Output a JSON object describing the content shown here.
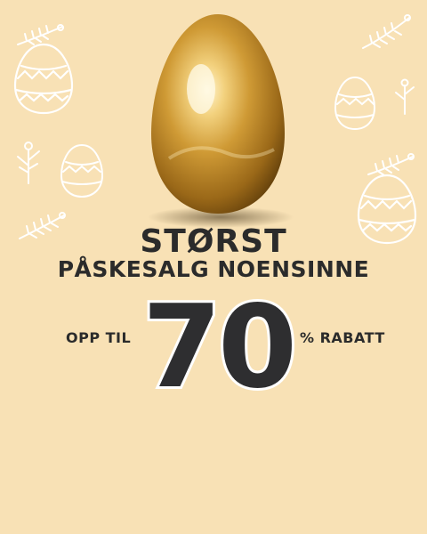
{
  "banner": {
    "headline": "STØRST",
    "subline": "PÅSKESALG NOENSINNE",
    "discount_prefix": "OPP TIL",
    "discount_value": "70",
    "discount_suffix": "% RABATT"
  },
  "colors": {
    "background": "#f8e1b5",
    "text": "#2b2b2b",
    "number_fill": "#2e2e30",
    "decor": "#ffffff",
    "gold": "#c9982f"
  },
  "icons": [
    "golden-egg-icon",
    "decorated-egg-icon",
    "flower-sprig-icon"
  ]
}
